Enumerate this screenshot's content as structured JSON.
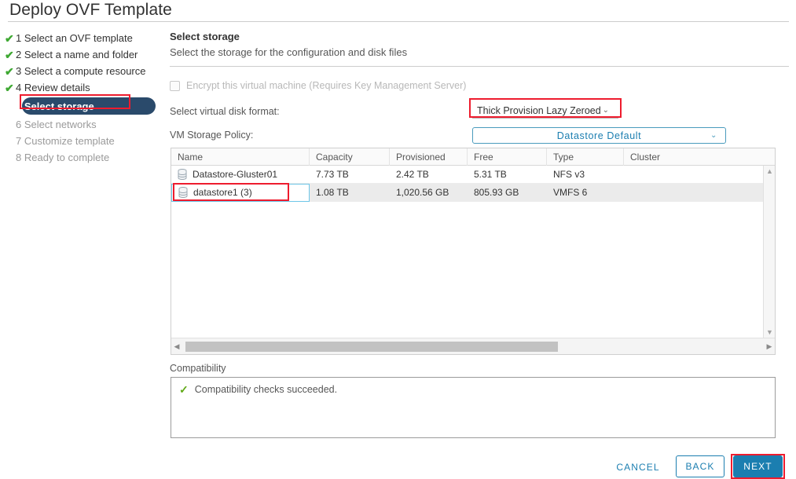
{
  "window": {
    "title": "Deploy OVF Template"
  },
  "nav": {
    "items": [
      {
        "label": "1 Select an OVF template",
        "state": "done"
      },
      {
        "label": "2 Select a name and folder",
        "state": "done"
      },
      {
        "label": "3 Select a compute resource",
        "state": "done"
      },
      {
        "label": "4 Review details",
        "state": "done"
      },
      {
        "label": "5 Select storage",
        "state": "current"
      },
      {
        "label": "6 Select networks",
        "state": "todo"
      },
      {
        "label": "7 Customize template",
        "state": "todo"
      },
      {
        "label": "8 Ready to complete",
        "state": "todo"
      }
    ],
    "check_glyph": "✔"
  },
  "pane": {
    "title": "Select storage",
    "subtitle": "Select the storage for the configuration and disk files"
  },
  "encrypt": {
    "label": "Encrypt this virtual machine (Requires Key Management Server)",
    "checked": false,
    "disabled": true
  },
  "disk_format": {
    "label": "Select virtual disk format:",
    "value": "Thick Provision Lazy Zeroed",
    "caret": "⌄"
  },
  "storage_policy": {
    "label": "VM Storage Policy:",
    "value": "Datastore Default",
    "caret": "⌄"
  },
  "table": {
    "columns": [
      "Name",
      "Capacity",
      "Provisioned",
      "Free",
      "Type",
      "Cluster"
    ],
    "rows": [
      {
        "name": "Datastore-Gluster01",
        "capacity": "7.73 TB",
        "provisioned": "2.42 TB",
        "free": "5.31 TB",
        "type": "NFS v3",
        "cluster": "",
        "selected": false
      },
      {
        "name": "datastore1 (3)",
        "capacity": "1.08 TB",
        "provisioned": "1,020.56 GB",
        "free": "805.93 GB",
        "type": "VMFS 6",
        "cluster": "",
        "selected": true
      }
    ],
    "scroll": {
      "left_arrow": "◀",
      "right_arrow": "▶",
      "up_arrow": "▲",
      "down_arrow": "▼"
    }
  },
  "compatibility": {
    "label": "Compatibility",
    "message": "Compatibility checks succeeded.",
    "check_glyph": "✓"
  },
  "footer": {
    "cancel": "CANCEL",
    "back": "BACK",
    "next": "NEXT"
  },
  "colors": {
    "accent": "#1b7eb0",
    "nav_selected_bg": "#2a4a6b",
    "annotation": "#ee1c2e",
    "success": "#60a917"
  }
}
